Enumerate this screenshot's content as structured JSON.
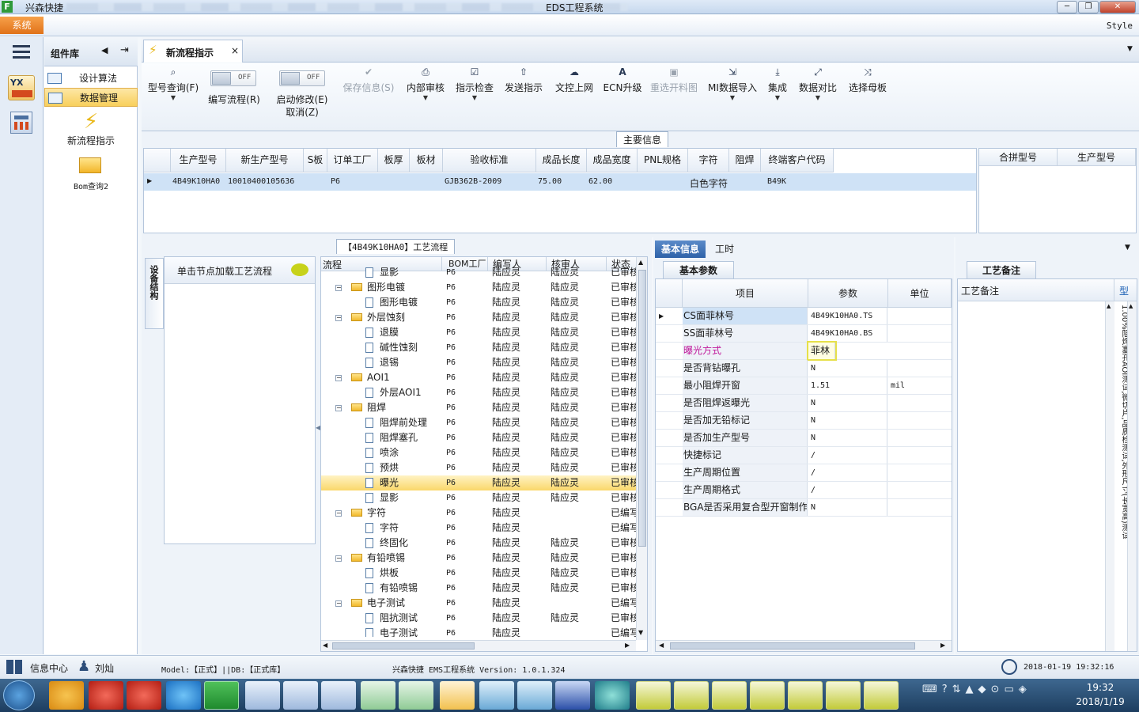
{
  "window": {
    "brand": "兴森快捷",
    "title": "EDS工程系统",
    "controls": [
      "─",
      "❐",
      "✕"
    ]
  },
  "menubar": {
    "system_label": "系统",
    "style_label": "Style"
  },
  "component_panel": {
    "title": "组件库",
    "items": [
      {
        "label": "设计算法"
      },
      {
        "label": "数据管理"
      }
    ],
    "tiles": [
      {
        "label": "新流程指示"
      },
      {
        "label": "Bom查询2"
      }
    ]
  },
  "tab": {
    "label": "新流程指示",
    "close": "×"
  },
  "toolbar": {
    "model_query": "型号查询(F)",
    "toggle_off": "OFF",
    "write_flow": "编写流程(R)",
    "enable_edit": "启动修改(E)",
    "cancel": "取消(Z)",
    "save": "保存信息(S)",
    "review": "内部审核",
    "check": "指示检查",
    "send": "发送指示",
    "upload": "文控上网",
    "ecn": "ECN升级",
    "reselect": "重选开料图",
    "mi_import": "MI数据导入",
    "integrate": "集成",
    "compare": "数据对比",
    "select_mother": "选择母板"
  },
  "main_info": {
    "section_title": "主要信息",
    "columns": [
      "生产型号",
      "新生产型号",
      "S板",
      "订单工厂",
      "板厚",
      "板材",
      "验收标准",
      "成品长度",
      "成品宽度",
      "PNL规格",
      "字符",
      "阻焊",
      "终端客户代码"
    ],
    "row": [
      "4B49K10HA0",
      "10010400105636",
      "",
      "P6",
      "",
      "",
      "GJB362B-2009",
      "75.00",
      "62.00",
      "",
      "白色字符",
      "",
      "B49K"
    ],
    "right_columns": [
      "合拼型号",
      "生产型号"
    ]
  },
  "flow_panel": {
    "section_title": "【4B49K10HA0】工艺流程",
    "side_tab": "设备结构",
    "hint": "单击节点加载工艺流程",
    "tree_columns": [
      "流程",
      "BOM工厂",
      "编写人",
      "核审人",
      "状态"
    ],
    "tree_rows": [
      {
        "name": "显影",
        "level": 1,
        "factory": "P6",
        "writer": "陆应灵",
        "reviewer": "陆应灵",
        "status": "已审核"
      },
      {
        "name": "图形电镀",
        "level": 0,
        "factory": "P6",
        "writer": "陆应灵",
        "reviewer": "陆应灵",
        "status": "已审核"
      },
      {
        "name": "图形电镀",
        "level": 1,
        "factory": "P6",
        "writer": "陆应灵",
        "reviewer": "陆应灵",
        "status": "已审核"
      },
      {
        "name": "外层蚀刻",
        "level": 0,
        "factory": "P6",
        "writer": "陆应灵",
        "reviewer": "陆应灵",
        "status": "已审核"
      },
      {
        "name": "退膜",
        "level": 1,
        "factory": "P6",
        "writer": "陆应灵",
        "reviewer": "陆应灵",
        "status": "已审核"
      },
      {
        "name": "碱性蚀刻",
        "level": 1,
        "factory": "P6",
        "writer": "陆应灵",
        "reviewer": "陆应灵",
        "status": "已审核"
      },
      {
        "name": "退锡",
        "level": 1,
        "factory": "P6",
        "writer": "陆应灵",
        "reviewer": "陆应灵",
        "status": "已审核"
      },
      {
        "name": "AOI1",
        "level": 0,
        "factory": "P6",
        "writer": "陆应灵",
        "reviewer": "陆应灵",
        "status": "已审核"
      },
      {
        "name": "外层AOI1",
        "level": 1,
        "factory": "P6",
        "writer": "陆应灵",
        "reviewer": "陆应灵",
        "status": "已审核"
      },
      {
        "name": "阻焊",
        "level": 0,
        "factory": "P6",
        "writer": "陆应灵",
        "reviewer": "陆应灵",
        "status": "已审核"
      },
      {
        "name": "阻焊前处理",
        "level": 1,
        "factory": "P6",
        "writer": "陆应灵",
        "reviewer": "陆应灵",
        "status": "已审核"
      },
      {
        "name": "阻焊塞孔",
        "level": 1,
        "factory": "P6",
        "writer": "陆应灵",
        "reviewer": "陆应灵",
        "status": "已审核"
      },
      {
        "name": "喷涂",
        "level": 1,
        "factory": "P6",
        "writer": "陆应灵",
        "reviewer": "陆应灵",
        "status": "已审核"
      },
      {
        "name": "预烘",
        "level": 1,
        "factory": "P6",
        "writer": "陆应灵",
        "reviewer": "陆应灵",
        "status": "已审核"
      },
      {
        "name": "曝光",
        "level": 1,
        "factory": "P6",
        "writer": "陆应灵",
        "reviewer": "陆应灵",
        "status": "已审核",
        "selected": true
      },
      {
        "name": "显影",
        "level": 1,
        "factory": "P6",
        "writer": "陆应灵",
        "reviewer": "陆应灵",
        "status": "已审核"
      },
      {
        "name": "字符",
        "level": 0,
        "factory": "P6",
        "writer": "陆应灵",
        "reviewer": "",
        "status": "已编写"
      },
      {
        "name": "字符",
        "level": 1,
        "factory": "P6",
        "writer": "陆应灵",
        "reviewer": "",
        "status": "已编写"
      },
      {
        "name": "终固化",
        "level": 1,
        "factory": "P6",
        "writer": "陆应灵",
        "reviewer": "陆应灵",
        "status": "已审核"
      },
      {
        "name": "有铅喷锡",
        "level": 0,
        "factory": "P6",
        "writer": "陆应灵",
        "reviewer": "陆应灵",
        "status": "已审核"
      },
      {
        "name": "烘板",
        "level": 1,
        "factory": "P6",
        "writer": "陆应灵",
        "reviewer": "陆应灵",
        "status": "已审核"
      },
      {
        "name": "有铅喷锡",
        "level": 1,
        "factory": "P6",
        "writer": "陆应灵",
        "reviewer": "陆应灵",
        "status": "已审核"
      },
      {
        "name": "电子测试",
        "level": 0,
        "factory": "P6",
        "writer": "陆应灵",
        "reviewer": "",
        "status": "已编写"
      },
      {
        "name": "阻抗测试",
        "level": 1,
        "factory": "P6",
        "writer": "陆应灵",
        "reviewer": "陆应灵",
        "status": "已审核"
      },
      {
        "name": "电子测试",
        "level": 1,
        "factory": "P6",
        "writer": "陆应灵",
        "reviewer": "",
        "status": "已编写"
      }
    ]
  },
  "basic_info": {
    "tabs": [
      "基本信息",
      "工时"
    ],
    "sub_tab": "基本参数",
    "columns": [
      "项目",
      "参数",
      "单位"
    ],
    "rows": [
      {
        "item": "CS面菲林号",
        "value": "4B49K10HA0.TS",
        "unit": ""
      },
      {
        "item": "SS面菲林号",
        "value": "4B49K10HA0.BS",
        "unit": ""
      },
      {
        "item": "曝光方式",
        "value": "菲林",
        "unit": "",
        "highlight": true
      },
      {
        "item": "是否背钻曝孔",
        "value": "N",
        "unit": ""
      },
      {
        "item": "最小阻焊开窗",
        "value": "1.51",
        "unit": "mil"
      },
      {
        "item": "是否阻焊返曝光",
        "value": "N",
        "unit": ""
      },
      {
        "item": "是否加无铅标记",
        "value": "N",
        "unit": ""
      },
      {
        "item": "是否加生产型号",
        "value": "N",
        "unit": ""
      },
      {
        "item": "快捷标记",
        "value": "/",
        "unit": ""
      },
      {
        "item": "生产周期位置",
        "value": "/",
        "unit": ""
      },
      {
        "item": "生产周期格式",
        "value": "/",
        "unit": ""
      },
      {
        "item": "BGA是否采用复合型开窗制作",
        "value": "N",
        "unit": ""
      }
    ]
  },
  "process_notes": {
    "tab": "工艺备注",
    "header": "工艺备注",
    "right_header": "型",
    "vertical_text": "1.00%阻焊塞孔AOI测试,微切片,品质检测试,外形尺寸(长宽高)测试"
  },
  "statusbar": {
    "info_center": "信息中心",
    "user": "刘灿",
    "model": "Model:【正式】||DB:【正式库】",
    "app": "兴森快捷 EMS工程系统 Version: 1.0.1.324",
    "datetime": "2018-01-19 19:32:16"
  },
  "taskbar": {
    "time": "19:32",
    "date": "2018/1/19"
  }
}
